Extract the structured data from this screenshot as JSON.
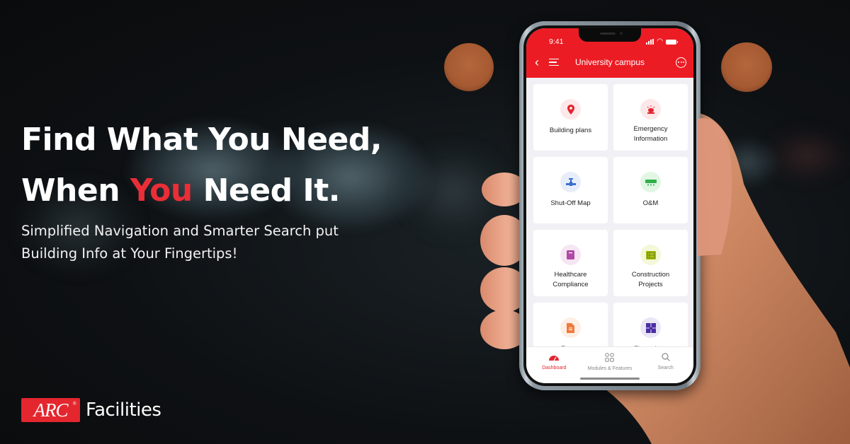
{
  "headline": {
    "line1": "Find What You Need,",
    "line2_pre": "When",
    "line2_accent": "You",
    "line2_post": "Need It."
  },
  "subtext": {
    "line1": "Simplified Navigation and Smarter Search put",
    "line2": "Building Info at Your Fingertips!"
  },
  "brand": {
    "logo_mark": "ARC",
    "logo_registered": "®",
    "logo_text": "Facilities",
    "accent_color": "#e4262e"
  },
  "phone": {
    "status_time": "9:41",
    "status_icons": [
      "signal-icon",
      "wifi-icon",
      "battery-icon"
    ],
    "header_title": "University campus",
    "header_icons": [
      "back-icon",
      "menu-icon",
      "more-icon"
    ],
    "modules": [
      {
        "label": "Building plans",
        "icon": "location-pin-icon",
        "color": "#e4262e",
        "bg": "#fde8e9"
      },
      {
        "label": "Emergency Information",
        "icon": "siren-icon",
        "color": "#e4262e",
        "bg": "#fde8e9"
      },
      {
        "label": "Shut-Off Map",
        "icon": "valve-icon",
        "color": "#3a6fd0",
        "bg": "#e7eef9"
      },
      {
        "label": "O&M",
        "icon": "hvac-icon",
        "color": "#2fb04a",
        "bg": "#e2f6e4"
      },
      {
        "label": "Healthcare Compliance",
        "icon": "clipboard-icon",
        "color": "#b04aa6",
        "bg": "#f6e6f4"
      },
      {
        "label": "Construction Projects",
        "icon": "blueprint-icon",
        "color": "#a8c418",
        "bg": "#f4f8d8"
      },
      {
        "label": "Forms",
        "icon": "form-document-icon",
        "color": "#ef7a3c",
        "bg": "#fdefe5"
      },
      {
        "label": "Floor plans",
        "icon": "floor-plan-icon",
        "color": "#4a2ea0",
        "bg": "#ebe6f6"
      }
    ],
    "tabs": [
      {
        "label": "Dashboard",
        "icon": "dashboard-gauge-icon",
        "active": true
      },
      {
        "label": "Modules & Features",
        "icon": "modules-grid-icon",
        "active": false
      },
      {
        "label": "Search",
        "icon": "search-icon",
        "active": false
      }
    ]
  }
}
